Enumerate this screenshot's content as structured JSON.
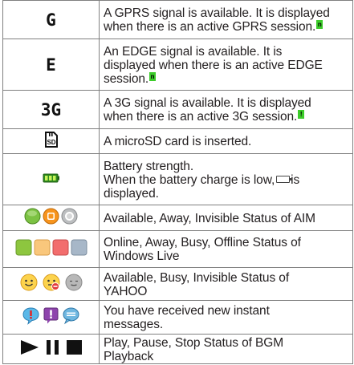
{
  "rows": [
    {
      "icon": "gprs-icon",
      "symbol": "G",
      "lines": [
        "A GPRS signal is available. It is displayed",
        "when there is an active GPRS session."
      ],
      "sub_glyph": "n"
    },
    {
      "icon": "edge-icon",
      "symbol": "E",
      "lines": [
        "An EDGE signal is available. It is",
        "displayed when there is an active EDGE",
        "session."
      ],
      "sub_glyph": "n"
    },
    {
      "icon": "3g-icon",
      "symbol": "3G",
      "lines": [
        "A 3G signal is available. It is displayed",
        "when there is an active 3G session."
      ],
      "sub_glyph": "!"
    },
    {
      "icon": "microsd-icon",
      "symbol": "SD",
      "lines": [
        "A microSD card is inserted."
      ]
    },
    {
      "icon": "battery-icon",
      "lines": [
        "Battery strength.",
        "When the battery charge is low,",
        "is",
        "displayed."
      ]
    },
    {
      "icon": "aim-status-icons",
      "lines": [
        "Available, Away, Invisible Status of AIM"
      ]
    },
    {
      "icon": "windows-live-status-icons",
      "lines": [
        "Online, Away, Busy, Offline Status of",
        "Windows Live"
      ]
    },
    {
      "icon": "yahoo-status-icons",
      "lines": [
        "Available, Busy, Invisible Status of",
        "YAHOO"
      ]
    },
    {
      "icon": "new-im-icons",
      "lines": [
        "You have received new instant",
        "messages."
      ]
    },
    {
      "icon": "bgm-playback-icons",
      "lines": [
        "Play, Pause, Stop Status of BGM",
        "Playback"
      ]
    }
  ],
  "colors": {
    "border": "#808080",
    "text": "#231f20",
    "aim_available": "#7cc243",
    "aim_away": "#f7941d",
    "aim_invisible": "#bcbec0",
    "live_online": "#8dc63f",
    "live_away": "#f9c77c",
    "live_busy": "#f26d6d",
    "live_offline": "#a7b7c8",
    "highlight_green": "#3ccc2a"
  }
}
